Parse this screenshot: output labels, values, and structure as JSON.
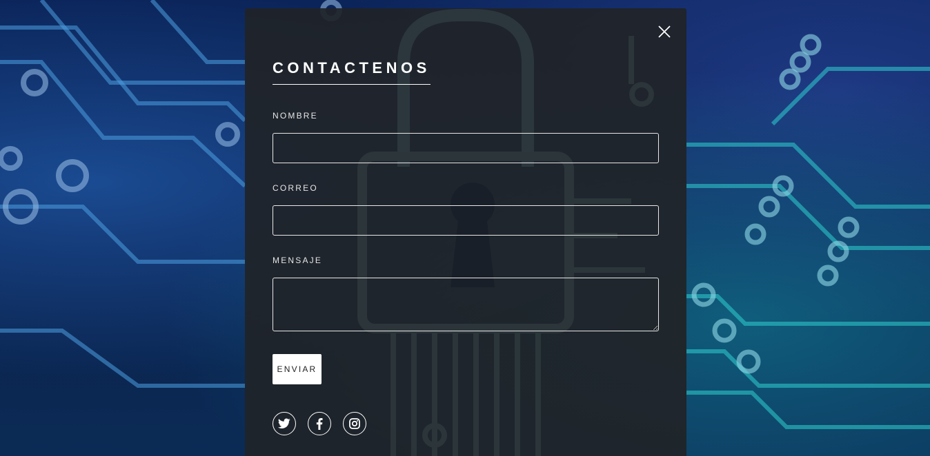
{
  "contact": {
    "title": "CONTACTENOS",
    "fields": [
      {
        "label": "NOMBRE",
        "value": "",
        "placeholder": ""
      },
      {
        "label": "CORREO",
        "value": "",
        "placeholder": ""
      },
      {
        "label": "MENSAJE",
        "value": "",
        "placeholder": ""
      }
    ],
    "submit_label": "ENVIAR"
  },
  "icons": {
    "close": "close-icon",
    "social": [
      "twitter-icon",
      "facebook-icon",
      "instagram-icon"
    ]
  },
  "colors": {
    "modal_background": "#202428",
    "text": "#ffffff",
    "button_background": "#ffffff",
    "button_text": "#222222"
  }
}
